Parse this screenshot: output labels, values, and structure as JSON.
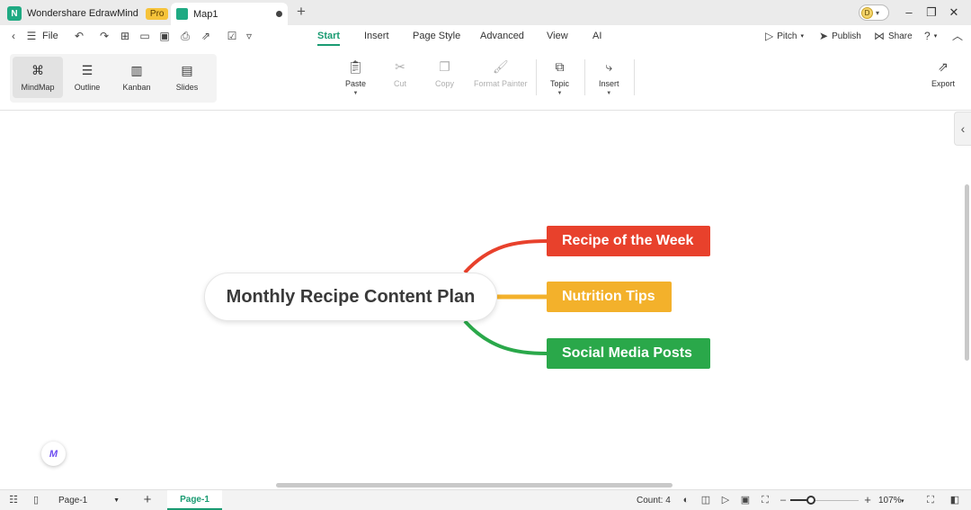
{
  "titlebar": {
    "app_name": "Wondershare EdrawMind",
    "pro_badge": "Pro",
    "doc_tab": "Map1",
    "new_tab_icon": "+",
    "avatar_initial": "D"
  },
  "menubar": {
    "file_label": "File",
    "tabs": [
      "Start",
      "Insert",
      "Page Style",
      "Advanced",
      "View",
      "AI"
    ],
    "active_tab": "Start",
    "right_actions": [
      {
        "label": "Pitch",
        "icon": "pitch-icon"
      },
      {
        "label": "Publish",
        "icon": "publish-icon"
      },
      {
        "label": "Share",
        "icon": "share-icon"
      }
    ]
  },
  "ribbon": {
    "views": [
      {
        "label": "MindMap",
        "icon": "mindmap-icon"
      },
      {
        "label": "Outline",
        "icon": "outline-icon"
      },
      {
        "label": "Kanban",
        "icon": "kanban-icon"
      },
      {
        "label": "Slides",
        "icon": "slides-icon"
      }
    ],
    "active_view": "MindMap",
    "buttons": [
      {
        "label": "Paste",
        "enabled": true
      },
      {
        "label": "Cut",
        "enabled": false
      },
      {
        "label": "Copy",
        "enabled": false
      },
      {
        "label": "Format Painter",
        "enabled": false
      },
      {
        "label": "Topic",
        "enabled": true
      },
      {
        "label": "Insert",
        "enabled": true
      }
    ],
    "export_label": "Export"
  },
  "mindmap": {
    "central_topic": "Monthly Recipe Content Plan",
    "topics": [
      {
        "label": "Recipe of the Week",
        "color": "#e8412c"
      },
      {
        "label": "Nutrition Tips",
        "color": "#f3b12b"
      },
      {
        "label": "Social Media Posts",
        "color": "#2aa84a"
      }
    ]
  },
  "statusbar": {
    "page_select": "Page-1",
    "active_page_tab": "Page-1",
    "count_label": "Count: 4",
    "zoom_value": "107%",
    "zoom_fraction": 0.3
  }
}
